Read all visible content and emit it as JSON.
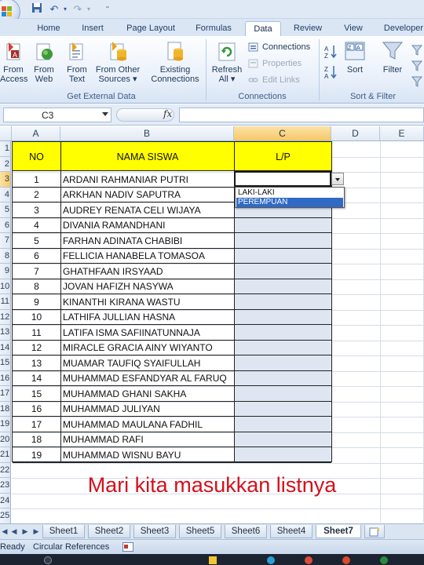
{
  "ribbon": {
    "tabs": [
      "Home",
      "Insert",
      "Page Layout",
      "Formulas",
      "Data",
      "Review",
      "View",
      "Developer"
    ],
    "active_tab": "Data",
    "get_external_data": {
      "label": "Get External Data",
      "buttons": [
        {
          "l1": "From",
          "l2": "Access"
        },
        {
          "l1": "From",
          "l2": "Web"
        },
        {
          "l1": "From",
          "l2": "Text"
        },
        {
          "l1": "From Other",
          "l2": "Sources ▾"
        },
        {
          "l1": "Existing",
          "l2": "Connections"
        }
      ]
    },
    "connections": {
      "label": "Connections",
      "refresh_l1": "Refresh",
      "refresh_l2": "All ▾",
      "items": [
        "Connections",
        "Properties",
        "Edit Links"
      ]
    },
    "sort_filter": {
      "label": "Sort & Filter",
      "sort": "Sort",
      "filter": "Filter"
    }
  },
  "formula_bar": {
    "name_box": "C3",
    "fx": "fx",
    "formula": ""
  },
  "columns": [
    "A",
    "B",
    "C",
    "D",
    "E"
  ],
  "rows": [
    "1",
    "2",
    "3",
    "4",
    "5",
    "6",
    "7",
    "8",
    "9",
    "10",
    "11",
    "12",
    "13",
    "14",
    "15",
    "16",
    "17",
    "18",
    "19",
    "20",
    "21",
    "22",
    "23",
    "24",
    "25"
  ],
  "table": {
    "headers": {
      "no": "NO",
      "name": "NAMA SISWA",
      "lp": "L/P"
    },
    "students": [
      {
        "no": "1",
        "name": "ARDANI RAHMANIAR PUTRI"
      },
      {
        "no": "2",
        "name": "ARKHAN NADIV SAPUTRA"
      },
      {
        "no": "3",
        "name": "AUDREY RENATA CELI WIJAYA"
      },
      {
        "no": "4",
        "name": "DIVANIA RAMANDHANI"
      },
      {
        "no": "5",
        "name": "FARHAN ADINATA CHABIBI"
      },
      {
        "no": "6",
        "name": "FELLICIA HANABELA TOMASOA"
      },
      {
        "no": "7",
        "name": "GHATHFAAN IRSYAAD"
      },
      {
        "no": "8",
        "name": "JOVAN HAFIZH NASYWA"
      },
      {
        "no": "9",
        "name": "KINANTHI KIRANA WASTU"
      },
      {
        "no": "10",
        "name": "LATHIFA JULLIAN HASNA"
      },
      {
        "no": "11",
        "name": "LATIFA ISMA SAFIINATUNNAJA"
      },
      {
        "no": "12",
        "name": "MIRACLE GRACIA AINY WIYANTO"
      },
      {
        "no": "13",
        "name": "MUAMAR TAUFIQ SYAIFULLAH"
      },
      {
        "no": "14",
        "name": "MUHAMMAD ESFANDYAR AL FARUQ"
      },
      {
        "no": "15",
        "name": "MUHAMMAD GHANI SAKHA"
      },
      {
        "no": "16",
        "name": "MUHAMMAD JULIYAN"
      },
      {
        "no": "17",
        "name": "MUHAMMAD MAULANA FADHIL"
      },
      {
        "no": "18",
        "name": "MUHAMMAD RAFI"
      },
      {
        "no": "19",
        "name": "MUHAMMAD WISNU BAYU"
      }
    ]
  },
  "dropdown": {
    "options": [
      "LAKI-LAKI",
      "PEREMPUAN"
    ],
    "highlighted": "PEREMPUAN"
  },
  "caption": "Mari kita masukkan listnya",
  "sheets": [
    "Sheet1",
    "Sheet2",
    "Sheet3",
    "Sheet5",
    "Sheet6",
    "Sheet4",
    "Sheet7"
  ],
  "active_sheet": "Sheet7",
  "status": {
    "ready": "Ready",
    "circular": "Circular References"
  },
  "colors": {
    "header_fill": "#ffff00",
    "caption": "#d4101c",
    "selection": "#316ac5"
  }
}
